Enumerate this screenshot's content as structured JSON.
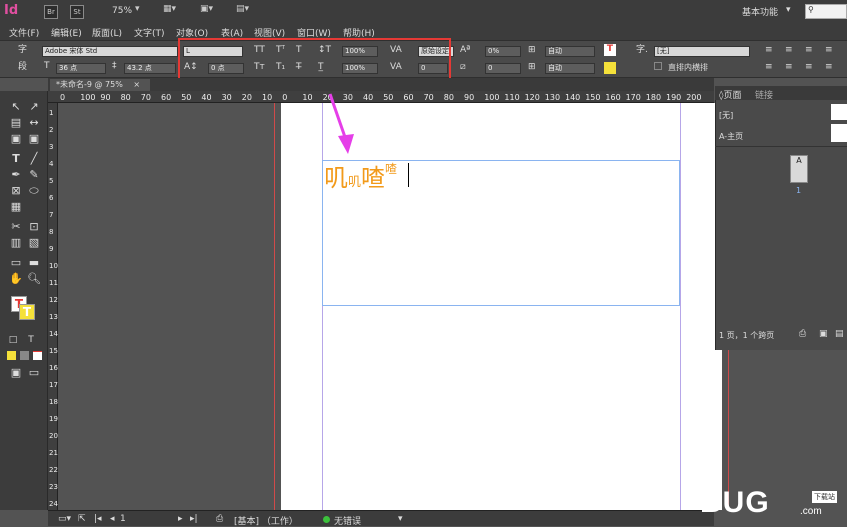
{
  "app": {
    "logo": "Id",
    "bridge_btn": "Br",
    "stock_btn": "St",
    "zoom": "75%",
    "workspace": "基本功能",
    "search_placeholder": "",
    "search_icon": "search-icon"
  },
  "menu": [
    "文件(F)",
    "编辑(E)",
    "版面(L)",
    "文字(T)",
    "对象(O)",
    "表(A)",
    "视图(V)",
    "窗口(W)",
    "帮助(H)"
  ],
  "control_panel": {
    "char_label": "字",
    "para_label": "段",
    "font_family": "Adobe 宋体 Std",
    "font_style": "L",
    "font_size": "36 点",
    "leading": "43.2 点",
    "kerning_value": "0 点",
    "scale_h": "100%",
    "scale_v": "100%",
    "tracking_method": "原始设定",
    "tracking": "0",
    "baseline": "0%",
    "baseline2": "0",
    "auto1": "自动",
    "auto2": "自动",
    "char_style": "[无]",
    "vertical_in_horizontal": "直排内横排"
  },
  "document_tab": {
    "title": "*未命名-9 @ 75%",
    "close": "×"
  },
  "ruler_h": [
    "0",
    "100",
    "90",
    "80",
    "70",
    "60",
    "50",
    "40",
    "30",
    "20",
    "10",
    "0",
    "10",
    "20",
    "30",
    "40",
    "50",
    "60",
    "70",
    "80",
    "90",
    "100",
    "110",
    "120",
    "130",
    "140",
    "150",
    "160",
    "170",
    "180",
    "190",
    "200"
  ],
  "ruler_v": [
    "1",
    "2",
    "3",
    "4",
    "5",
    "6",
    "7",
    "8",
    "9",
    "10",
    "11",
    "12",
    "13",
    "14",
    "15",
    "16",
    "17",
    "18",
    "19",
    "20",
    "21",
    "22",
    "23",
    "24"
  ],
  "canvas_text": {
    "char1": "叽",
    "char2_sub": "叽",
    "char3": "喳",
    "char4_sup": "喳"
  },
  "pages_panel": {
    "tab_pages": "页面",
    "tab_links": "链接",
    "none_master": "[无]",
    "a_master": "A-主页",
    "page_letter": "A",
    "page_number": "1",
    "summary": "1 页，1 个跨页"
  },
  "status_bar": {
    "page_field": "1",
    "master": "[基本] （工作）",
    "preflight": "无错误"
  },
  "watermark": {
    "text": "BUG",
    "tag": "下载站",
    "sub": ".com"
  },
  "colors": {
    "annotation_red": "#e53935",
    "arrow_magenta": "#e53ee8",
    "text_orange": "#f29a1a",
    "frame_blue": "#8ab4f0"
  }
}
